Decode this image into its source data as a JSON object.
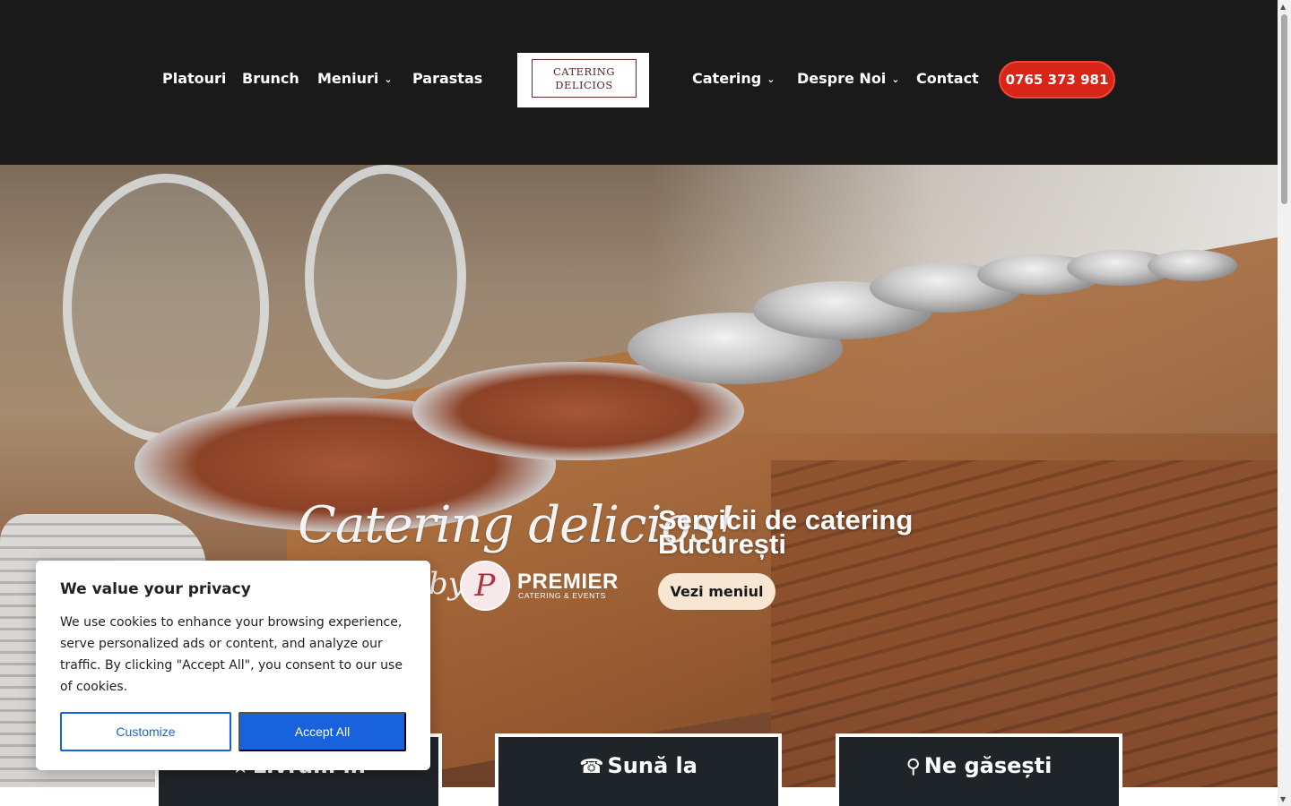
{
  "header": {
    "nav_left": [
      {
        "label": "Platouri",
        "dropdown": false
      },
      {
        "label": "Brunch",
        "dropdown": false
      },
      {
        "label": "Meniuri",
        "dropdown": true
      },
      {
        "label": "Parastas",
        "dropdown": false
      }
    ],
    "logo": {
      "line1": "CATERING",
      "line2": "DELICIOS"
    },
    "nav_right": [
      {
        "label": "Catering",
        "dropdown": true
      },
      {
        "label": "Despre Noi",
        "dropdown": true
      },
      {
        "label": "Contact",
        "dropdown": false
      }
    ],
    "phone": "0765 373 981",
    "chevron_glyph": "⌄"
  },
  "hero": {
    "script_title": "Catering delicios!",
    "by": "by",
    "premier_mark": "P",
    "premier_name": "PREMIER",
    "premier_tagline": "CATERING & EVENTS",
    "heading": "Servicii de catering București",
    "cta": "Vezi meniul"
  },
  "info_boxes": [
    {
      "icon": "bookmark-icon",
      "glyph": "★",
      "title": "Livrăm în"
    },
    {
      "icon": "phone-icon",
      "glyph": "☎",
      "title": "Sună la"
    },
    {
      "icon": "map-pin-icon",
      "glyph": "⚲",
      "title": "Ne găsești"
    }
  ],
  "cookie_banner": {
    "title": "We value your privacy",
    "text": "We use cookies to enhance your browsing experience, serve personalized ads or content, and analyze our traffic. By clicking \"Accept All\", you consent to our use of cookies.",
    "customize": "Customize",
    "accept": "Accept All"
  },
  "colors": {
    "header_bg": "#1a1a1a",
    "phone_btn": "#d92418",
    "cta_bg": "#f7e6d2",
    "info_box_bg": "#1f2429",
    "cookie_accent": "#1863dc"
  }
}
